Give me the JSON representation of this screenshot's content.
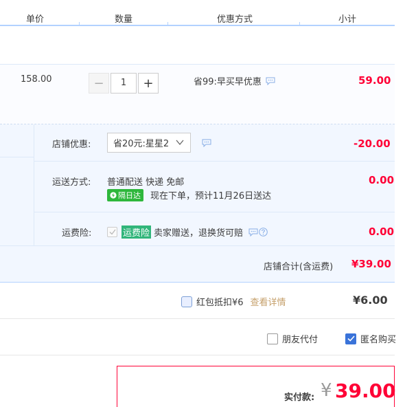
{
  "header": {
    "col_unit_price": "单价",
    "col_quantity": "数量",
    "col_discount": "优惠方式",
    "col_subtotal": "小计"
  },
  "item": {
    "unit_price": "158.00",
    "quantity": "1",
    "minus_label": "−",
    "plus_label": "+",
    "promo_text": "省99:早买早优惠",
    "subtotal": "59.00"
  },
  "shop": {
    "discount_label": "店铺优惠:",
    "discount_selected": "省20元:星星2",
    "discount_amount": "-20.00",
    "shipping_label": "运送方式:",
    "shipping_method": "普通配送 快递 免邮",
    "next_day_badge": "隔日达",
    "shipping_eta": "现在下单，预计11月26日送达",
    "shipping_amount": "0.00",
    "insurance_label": "运费险:",
    "insurance_tag": "运费险",
    "insurance_text": "卖家赠送，退换货可赔",
    "insurance_amount": "0.00",
    "total_label": "店铺合计(含运费)",
    "total_amount": "¥39.00"
  },
  "redpacket": {
    "label": "红包抵扣¥6",
    "details_link": "查看详情",
    "amount": "¥6.00"
  },
  "options": {
    "friend_pay": "朋友代付",
    "anonymous": "匿名购买"
  },
  "payment": {
    "label": "实付款:",
    "currency": "¥",
    "amount": "39.00"
  },
  "colors": {
    "accent_red": "#ff0036",
    "border_blue": "#b2d1ff",
    "badge_green": "#2eb73c",
    "checkbox_blue": "#3a73d9"
  }
}
